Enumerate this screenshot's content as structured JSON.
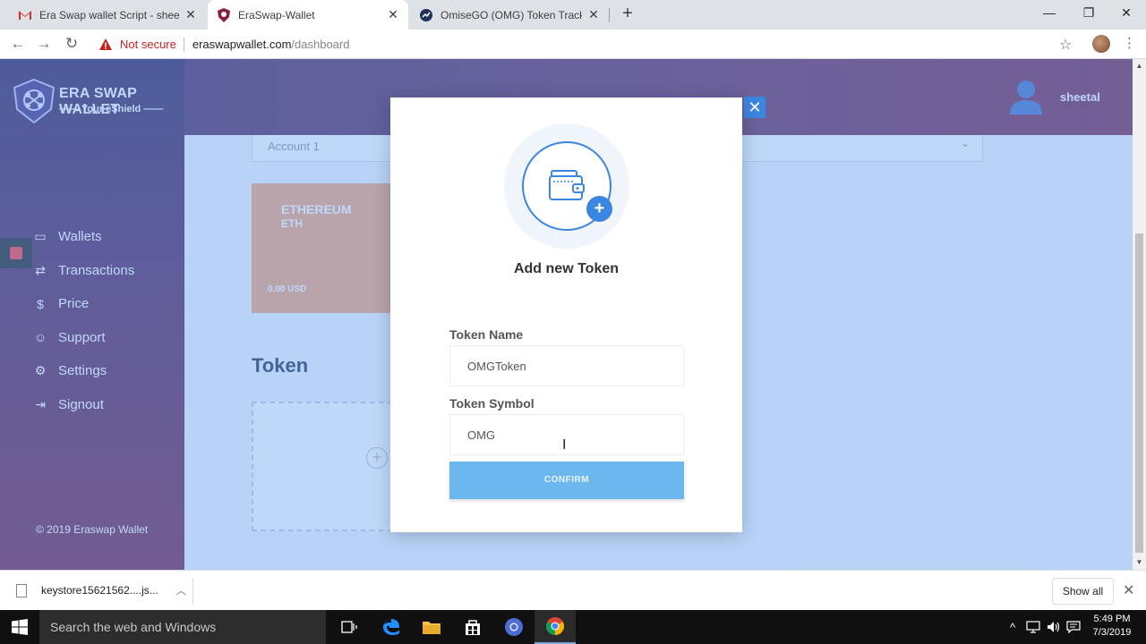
{
  "browser": {
    "tabs": [
      {
        "label": "Era Swap wallet Script - sheetalp",
        "icon": "gmail-icon"
      },
      {
        "label": "EraSwap-Wallet",
        "icon": "eraswap-shield-icon",
        "active": true
      },
      {
        "label": "OmiseGO (OMG) Token Tracker",
        "icon": "etherscan-icon"
      }
    ],
    "security_label": "Not secure",
    "url_host": "eraswapwallet.com",
    "url_path": "/dashboard"
  },
  "app": {
    "logo_title": "ERA SWAP WALLET",
    "logo_subtitle": "—— Your eShield ——",
    "user_name": "sheetal",
    "menu": [
      {
        "label": "Wallets",
        "icon": "wallet-icon"
      },
      {
        "label": "Transactions",
        "icon": "transfer-icon"
      },
      {
        "label": "Price",
        "icon": "dollar-icon"
      },
      {
        "label": "Support",
        "icon": "support-icon"
      },
      {
        "label": "Settings",
        "icon": "gear-icon"
      },
      {
        "label": "Signout",
        "icon": "signout-icon"
      }
    ],
    "copyright": "© 2019 Eraswap Wallet"
  },
  "dashboard": {
    "account_select": "Account 1",
    "eth_card": {
      "name": "ETHEREUM",
      "symbol": "ETH",
      "value": "0.00 USD"
    },
    "token_heading": "Token"
  },
  "modal": {
    "title": "Add new Token",
    "token_name_label": "Token Name",
    "token_name_value": "OMGToken",
    "token_symbol_label": "Token Symbol",
    "token_symbol_value": "OMG",
    "confirm_label": "CONFIRM"
  },
  "downloads": {
    "file_name": "keystore15621562....js...",
    "show_all": "Show all"
  },
  "taskbar": {
    "search_placeholder": "Search the web and Windows",
    "time": "5:49 PM",
    "date": "7/3/2019"
  },
  "colors": {
    "accent": "#3a86e0",
    "confirm_button": "#6cb8ee",
    "eth_card": "#f4a77a",
    "sidebar": "#5a2e5e",
    "overlay": "#66a0f0"
  }
}
